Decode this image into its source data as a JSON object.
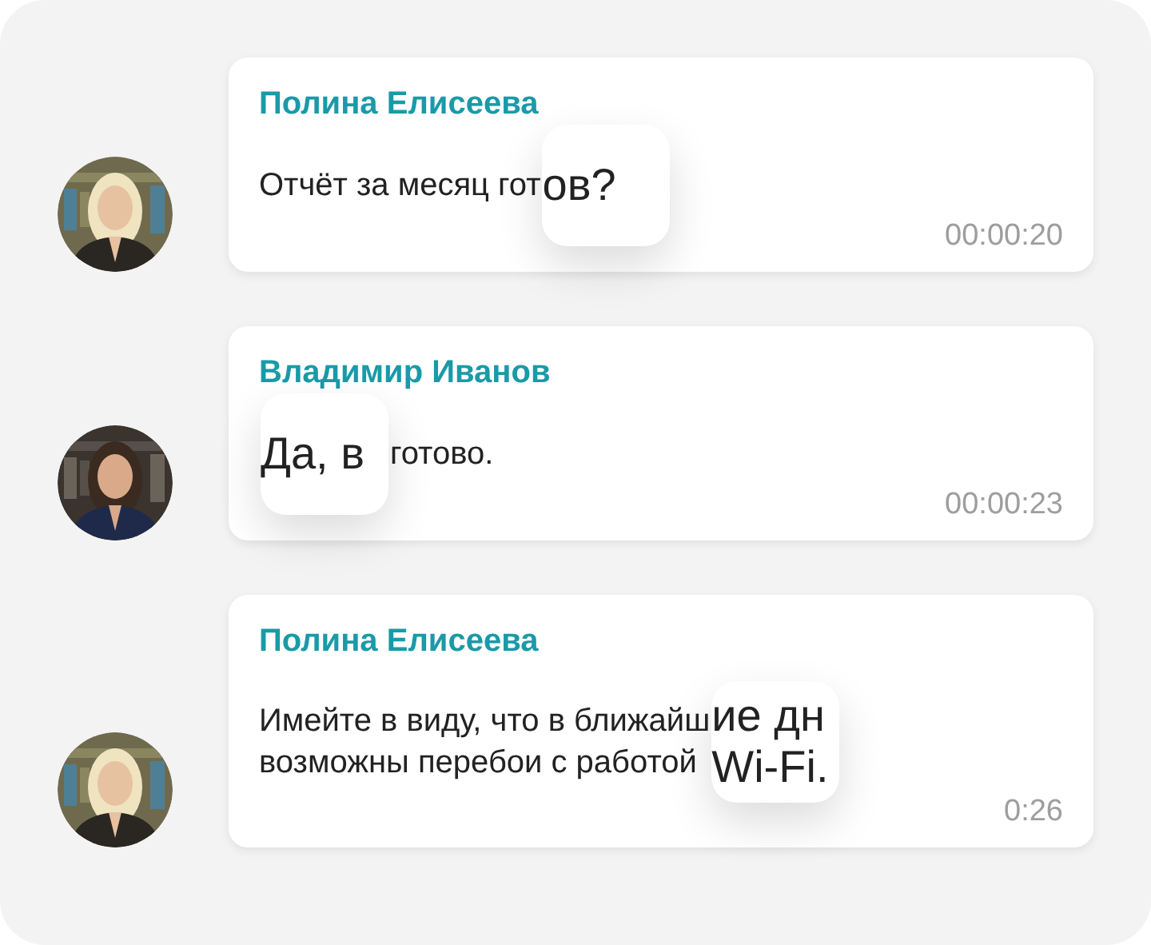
{
  "messages": [
    {
      "author": "Полина Елисеева",
      "avatar": {
        "kind": "picture"
      },
      "segments": [
        {
          "kind": "plain",
          "lines": [
            "Отчёт за месяц гот"
          ]
        },
        {
          "kind": "lens",
          "lines": [
            "ов?"
          ]
        }
      ],
      "time": "00:00:20"
    },
    {
      "author": "Владимир Иванов",
      "avatar": {
        "kind": "picture"
      },
      "segments": [
        {
          "kind": "lens",
          "lines": [
            "Да, в"
          ]
        },
        {
          "kind": "plain",
          "lines": [
            "готово."
          ]
        }
      ],
      "time": "00:00:23"
    },
    {
      "author": "Полина Елисеева",
      "avatar": {
        "kind": "picture"
      },
      "segments": [
        {
          "kind": "plain",
          "lines": [
            "Имейте в виду, что в ближайш",
            "возможны перебои с работой"
          ]
        },
        {
          "kind": "lens",
          "lines": [
            "ие дн",
            "Wi-Fi."
          ]
        }
      ],
      "time": "0:26"
    }
  ]
}
